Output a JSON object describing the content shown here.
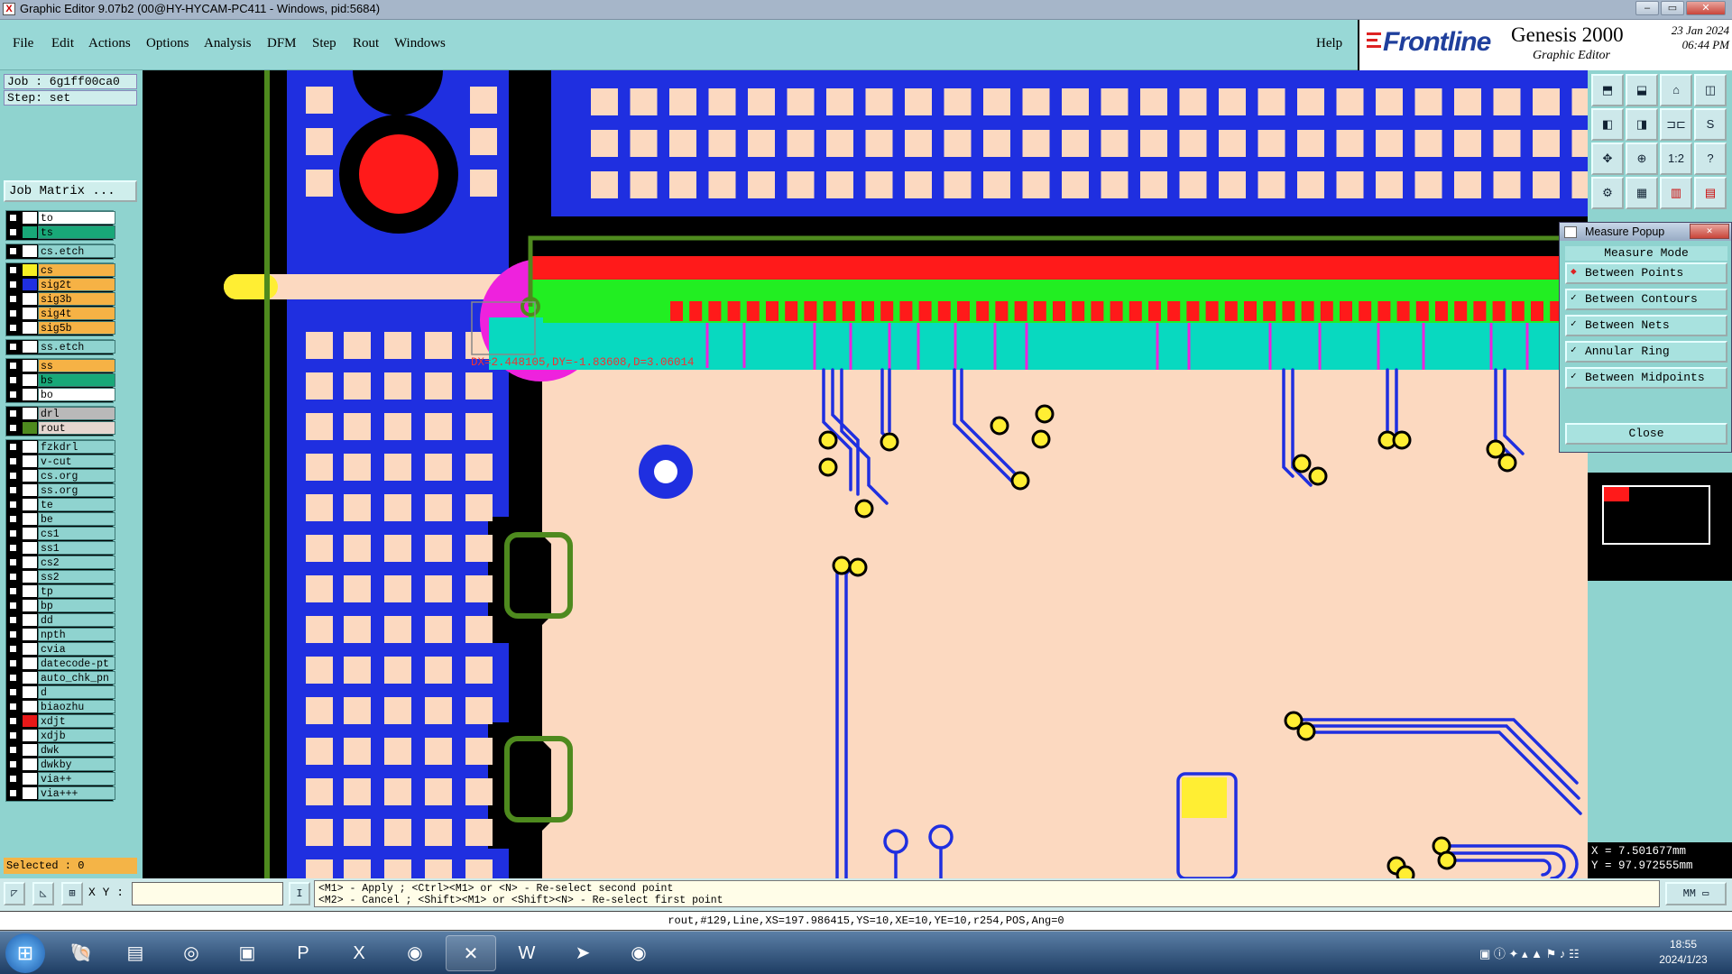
{
  "window": {
    "title": "Graphic Editor 9.07b2 (00@HY-HYCAM-PC411 - Windows, pid:5684)",
    "minimize": "–",
    "maximize": "▭",
    "close": "✕"
  },
  "menu": {
    "items": [
      {
        "label": "File"
      },
      {
        "label": "Edit"
      },
      {
        "label": "Actions"
      },
      {
        "label": "Options"
      },
      {
        "label": "Analysis"
      },
      {
        "label": "DFM"
      },
      {
        "label": "Step"
      },
      {
        "label": "Rout"
      },
      {
        "label": "Windows"
      }
    ],
    "help": "Help"
  },
  "brand": {
    "logo": "Frontline",
    "product": "Genesis 2000",
    "subtitle": "Graphic Editor",
    "date": "23 Jan 2024",
    "time": "06:44 PM"
  },
  "job": {
    "job_label": "Job : 6g1ff00ca0",
    "step_label": "Step: set",
    "matrix_button": "Job Matrix ..."
  },
  "layers": [
    {
      "name": "to",
      "color": "#ffffff",
      "swatch": "#ffffff",
      "group": 0
    },
    {
      "name": "ts",
      "color": "#18a878",
      "swatch": "#18a878",
      "group": 0
    },
    {
      "name": "cs.etch",
      "color": "#8fd3cf",
      "swatch": "#ffffff",
      "group": 1
    },
    {
      "name": "cs",
      "color": "#f6b245",
      "swatch": "#f7ef23",
      "group": 2
    },
    {
      "name": "sig2t",
      "color": "#f6b245",
      "swatch": "#1f2fe0",
      "group": 2
    },
    {
      "name": "sig3b",
      "color": "#f6b245",
      "swatch": "#ffffff",
      "group": 2
    },
    {
      "name": "sig4t",
      "color": "#f6b245",
      "swatch": "#ffffff",
      "group": 2
    },
    {
      "name": "sig5b",
      "color": "#f6b245",
      "swatch": "#ffffff",
      "group": 2
    },
    {
      "name": "ss.etch",
      "color": "#8fd3cf",
      "swatch": "#ffffff",
      "group": 3
    },
    {
      "name": "ss",
      "color": "#f6b245",
      "swatch": "#ffffff",
      "group": 4
    },
    {
      "name": "bs",
      "color": "#18a878",
      "swatch": "#ffffff",
      "group": 4
    },
    {
      "name": "bo",
      "color": "#ffffff",
      "swatch": "#ffffff",
      "group": 4
    },
    {
      "name": "drl",
      "color": "#b9b9b9",
      "swatch": "#ffffff",
      "group": 5
    },
    {
      "name": "rout",
      "color": "#e6d6d0",
      "swatch": "#4e8a1e",
      "group": 5
    },
    {
      "name": "fzkdrl",
      "color": "#8fd3cf",
      "swatch": "#ffffff",
      "group": 6
    },
    {
      "name": "v-cut",
      "color": "#8fd3cf",
      "swatch": "#ffffff",
      "group": 6
    },
    {
      "name": "cs.org",
      "color": "#8fd3cf",
      "swatch": "#ffffff",
      "group": 6
    },
    {
      "name": "ss.org",
      "color": "#8fd3cf",
      "swatch": "#ffffff",
      "group": 6
    },
    {
      "name": "te",
      "color": "#8fd3cf",
      "swatch": "#ffffff",
      "group": 6
    },
    {
      "name": "be",
      "color": "#8fd3cf",
      "swatch": "#ffffff",
      "group": 6
    },
    {
      "name": "cs1",
      "color": "#8fd3cf",
      "swatch": "#ffffff",
      "group": 6
    },
    {
      "name": "ss1",
      "color": "#8fd3cf",
      "swatch": "#ffffff",
      "group": 6
    },
    {
      "name": "cs2",
      "color": "#8fd3cf",
      "swatch": "#ffffff",
      "group": 6
    },
    {
      "name": "ss2",
      "color": "#8fd3cf",
      "swatch": "#ffffff",
      "group": 6
    },
    {
      "name": "tp",
      "color": "#8fd3cf",
      "swatch": "#ffffff",
      "group": 6
    },
    {
      "name": "bp",
      "color": "#8fd3cf",
      "swatch": "#ffffff",
      "group": 6
    },
    {
      "name": "dd",
      "color": "#8fd3cf",
      "swatch": "#ffffff",
      "group": 6
    },
    {
      "name": "npth",
      "color": "#8fd3cf",
      "swatch": "#ffffff",
      "group": 6
    },
    {
      "name": "cvia",
      "color": "#8fd3cf",
      "swatch": "#ffffff",
      "group": 6
    },
    {
      "name": "datecode-pt",
      "color": "#8fd3cf",
      "swatch": "#ffffff",
      "group": 6
    },
    {
      "name": "auto_chk_pn",
      "color": "#8fd3cf",
      "swatch": "#ffffff",
      "group": 6
    },
    {
      "name": "d",
      "color": "#8fd3cf",
      "swatch": "#ffffff",
      "group": 6
    },
    {
      "name": "biaozhu",
      "color": "#8fd3cf",
      "swatch": "#ffffff",
      "group": 6
    },
    {
      "name": "xdjt",
      "color": "#8fd3cf",
      "swatch": "#e81818",
      "group": 6
    },
    {
      "name": "xdjb",
      "color": "#8fd3cf",
      "swatch": "#ffffff",
      "group": 6
    },
    {
      "name": "dwk",
      "color": "#8fd3cf",
      "swatch": "#ffffff",
      "group": 6
    },
    {
      "name": "dwkby",
      "color": "#8fd3cf",
      "swatch": "#ffffff",
      "group": 6
    },
    {
      "name": "via++",
      "color": "#8fd3cf",
      "swatch": "#ffffff",
      "group": 6
    },
    {
      "name": "via+++",
      "color": "#8fd3cf",
      "swatch": "#ffffff",
      "group": 6
    }
  ],
  "selected": "Selected : 0",
  "measure": {
    "dim_text": "DX=2.448105,DY=-1.83608,D=3.06014"
  },
  "popup": {
    "title": "Measure Popup",
    "header": "Measure Mode",
    "modes": [
      "Between Points",
      "Between Contours",
      "Between Nets",
      "Annular Ring",
      "Between Midpoints"
    ],
    "close": "Close"
  },
  "coords": {
    "x": "X = 7.501677mm",
    "y": "Y = 97.972555mm"
  },
  "bottom": {
    "xy_label": "X Y :",
    "xy_value": "",
    "hint1": "<M1> - Apply  ; <Ctrl><M1> or <N> - Re-select second point",
    "hint2": "<M2> - Cancel ; <Shift><M1> or <Shift><N> - Re-select first point",
    "units": "MM"
  },
  "status": "rout,#129,Line,XS=197.986415,YS=10,XE=10,YE=10,r254,POS,Ang=0",
  "clock": {
    "time": "18:55",
    "date": "2024/1/23"
  }
}
